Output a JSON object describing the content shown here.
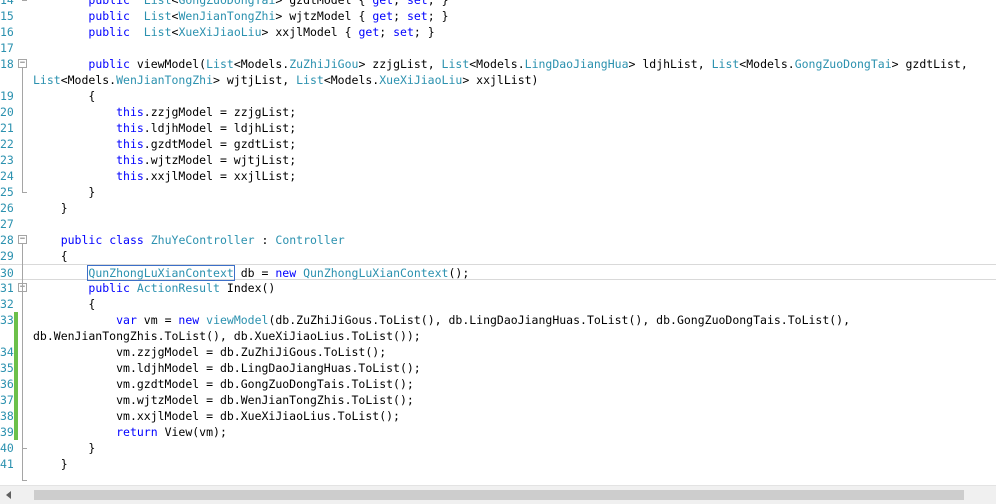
{
  "editor": {
    "lines": [
      {
        "n": "14",
        "indent": "        ",
        "tokens": [
          [
            "kw",
            "public"
          ],
          [
            "",
            "  "
          ],
          [
            "ty",
            "List"
          ],
          [
            "",
            "<"
          ],
          [
            "ty",
            "GongZuoDongTai"
          ],
          [
            "",
            "> gzdtModel { "
          ],
          [
            "kw",
            "get"
          ],
          [
            "",
            "; "
          ],
          [
            "kw",
            "set"
          ],
          [
            "",
            "; }"
          ]
        ]
      },
      {
        "n": "15",
        "indent": "        ",
        "tokens": [
          [
            "kw",
            "public"
          ],
          [
            "",
            "  "
          ],
          [
            "ty",
            "List"
          ],
          [
            "",
            "<"
          ],
          [
            "ty",
            "WenJianTongZhi"
          ],
          [
            "",
            "> wjtzModel { "
          ],
          [
            "kw",
            "get"
          ],
          [
            "",
            "; "
          ],
          [
            "kw",
            "set"
          ],
          [
            "",
            "; }"
          ]
        ]
      },
      {
        "n": "16",
        "indent": "        ",
        "tokens": [
          [
            "kw",
            "public"
          ],
          [
            "",
            "  "
          ],
          [
            "ty",
            "List"
          ],
          [
            "",
            "<"
          ],
          [
            "ty",
            "XueXiJiaoLiu"
          ],
          [
            "",
            "> xxjlModel { "
          ],
          [
            "kw",
            "get"
          ],
          [
            "",
            "; "
          ],
          [
            "kw",
            "set"
          ],
          [
            "",
            "; }"
          ]
        ]
      },
      {
        "n": "17",
        "indent": "",
        "tokens": []
      },
      {
        "n": "18",
        "indent": "        ",
        "tokens": [
          [
            "kw",
            "public"
          ],
          [
            "",
            " viewModel("
          ],
          [
            "ty",
            "List"
          ],
          [
            "",
            "<Models."
          ],
          [
            "ty",
            "ZuZhiJiGou"
          ],
          [
            "",
            "> zzjgList, "
          ],
          [
            "ty",
            "List"
          ],
          [
            "",
            "<Models."
          ],
          [
            "ty",
            "LingDaoJiangHua"
          ],
          [
            "",
            "> ldjhList, "
          ],
          [
            "ty",
            "List"
          ],
          [
            "",
            "<Models."
          ],
          [
            "ty",
            "GongZuoDongTai"
          ],
          [
            "",
            "> gzdtList,"
          ]
        ]
      },
      {
        "n": "",
        "indent": "",
        "tokens": [
          [
            "ty",
            "List"
          ],
          [
            "",
            "<Models."
          ],
          [
            "ty",
            "WenJianTongZhi"
          ],
          [
            "",
            "> wjtjList, "
          ],
          [
            "ty",
            "List"
          ],
          [
            "",
            "<Models."
          ],
          [
            "ty",
            "XueXiJiaoLiu"
          ],
          [
            "",
            "> xxjlList)"
          ]
        ]
      },
      {
        "n": "19",
        "indent": "        ",
        "tokens": [
          [
            "",
            "{"
          ]
        ]
      },
      {
        "n": "20",
        "indent": "            ",
        "tokens": [
          [
            "kw",
            "this"
          ],
          [
            "",
            ".zzjgModel = zzjgList;"
          ]
        ]
      },
      {
        "n": "21",
        "indent": "            ",
        "tokens": [
          [
            "kw",
            "this"
          ],
          [
            "",
            ".ldjhModel = ldjhList;"
          ]
        ]
      },
      {
        "n": "22",
        "indent": "            ",
        "tokens": [
          [
            "kw",
            "this"
          ],
          [
            "",
            ".gzdtModel = gzdtList;"
          ]
        ]
      },
      {
        "n": "23",
        "indent": "            ",
        "tokens": [
          [
            "kw",
            "this"
          ],
          [
            "",
            ".wjtzModel = wjtjList;"
          ]
        ]
      },
      {
        "n": "24",
        "indent": "            ",
        "tokens": [
          [
            "kw",
            "this"
          ],
          [
            "",
            ".xxjlModel = xxjlList;"
          ]
        ]
      },
      {
        "n": "25",
        "indent": "        ",
        "tokens": [
          [
            "",
            "}"
          ]
        ]
      },
      {
        "n": "26",
        "indent": "    ",
        "tokens": [
          [
            "",
            "}"
          ]
        ]
      },
      {
        "n": "27",
        "indent": "",
        "tokens": []
      },
      {
        "n": "28",
        "indent": "    ",
        "tokens": [
          [
            "kw",
            "public"
          ],
          [
            "",
            " "
          ],
          [
            "kw",
            "class"
          ],
          [
            "",
            " "
          ],
          [
            "ty",
            "ZhuYeController"
          ],
          [
            "",
            " : "
          ],
          [
            "ty",
            "Controller"
          ]
        ]
      },
      {
        "n": "29",
        "indent": "    ",
        "tokens": [
          [
            "",
            "{"
          ]
        ]
      },
      {
        "n": "30",
        "indent": "        ",
        "tokens": [
          [
            "ty",
            "QunZhongLuXianContext"
          ],
          [
            "",
            " db = "
          ],
          [
            "kw",
            "new"
          ],
          [
            "",
            " "
          ],
          [
            "ty",
            "QunZhongLuXianContext"
          ],
          [
            "",
            "();"
          ]
        ]
      },
      {
        "n": "31",
        "indent": "        ",
        "tokens": [
          [
            "kw",
            "public"
          ],
          [
            "",
            " "
          ],
          [
            "ty",
            "ActionResult"
          ],
          [
            "",
            " Index()"
          ]
        ]
      },
      {
        "n": "32",
        "indent": "        ",
        "tokens": [
          [
            "",
            "{"
          ]
        ]
      },
      {
        "n": "33",
        "indent": "            ",
        "tokens": [
          [
            "kw",
            "var"
          ],
          [
            "",
            " vm = "
          ],
          [
            "kw",
            "new"
          ],
          [
            "",
            " "
          ],
          [
            "ty",
            "viewModel"
          ],
          [
            "",
            "(db.ZuZhiJiGous.ToList(), db.LingDaoJiangHuas.ToList(), db.GongZuoDongTais.ToList(),"
          ]
        ]
      },
      {
        "n": "",
        "indent": "",
        "tokens": [
          [
            "",
            "db.WenJianTongZhis.ToList(), db.XueXiJiaoLius.ToList());"
          ]
        ]
      },
      {
        "n": "34",
        "indent": "            ",
        "tokens": [
          [
            "",
            "vm.zzjgModel = db.ZuZhiJiGous.ToList();"
          ]
        ]
      },
      {
        "n": "35",
        "indent": "            ",
        "tokens": [
          [
            "",
            "vm.ldjhModel = db.LingDaoJiangHuas.ToList();"
          ]
        ]
      },
      {
        "n": "36",
        "indent": "            ",
        "tokens": [
          [
            "",
            "vm.gzdtModel = db.GongZuoDongTais.ToList();"
          ]
        ]
      },
      {
        "n": "37",
        "indent": "            ",
        "tokens": [
          [
            "",
            "vm.wjtzModel = db.WenJianTongZhis.ToList();"
          ]
        ]
      },
      {
        "n": "38",
        "indent": "            ",
        "tokens": [
          [
            "",
            "vm.xxjlModel = db.XueXiJiaoLius.ToList();"
          ]
        ]
      },
      {
        "n": "39",
        "indent": "            ",
        "tokens": [
          [
            "kw",
            "return"
          ],
          [
            "",
            " View(vm);"
          ]
        ]
      },
      {
        "n": "40",
        "indent": "        ",
        "tokens": [
          [
            "",
            "}"
          ]
        ]
      },
      {
        "n": "41",
        "indent": "    ",
        "tokens": [
          [
            "",
            "}"
          ]
        ]
      }
    ]
  },
  "colors": {
    "keyword": "#0000ff",
    "type": "#2b91af",
    "text": "#000000",
    "line_number": "#2b91af",
    "saved_change": "#6cc04a"
  },
  "icons": {
    "fold_collapse": "minus-box-icon",
    "scroll_left": "arrow-left-icon"
  }
}
